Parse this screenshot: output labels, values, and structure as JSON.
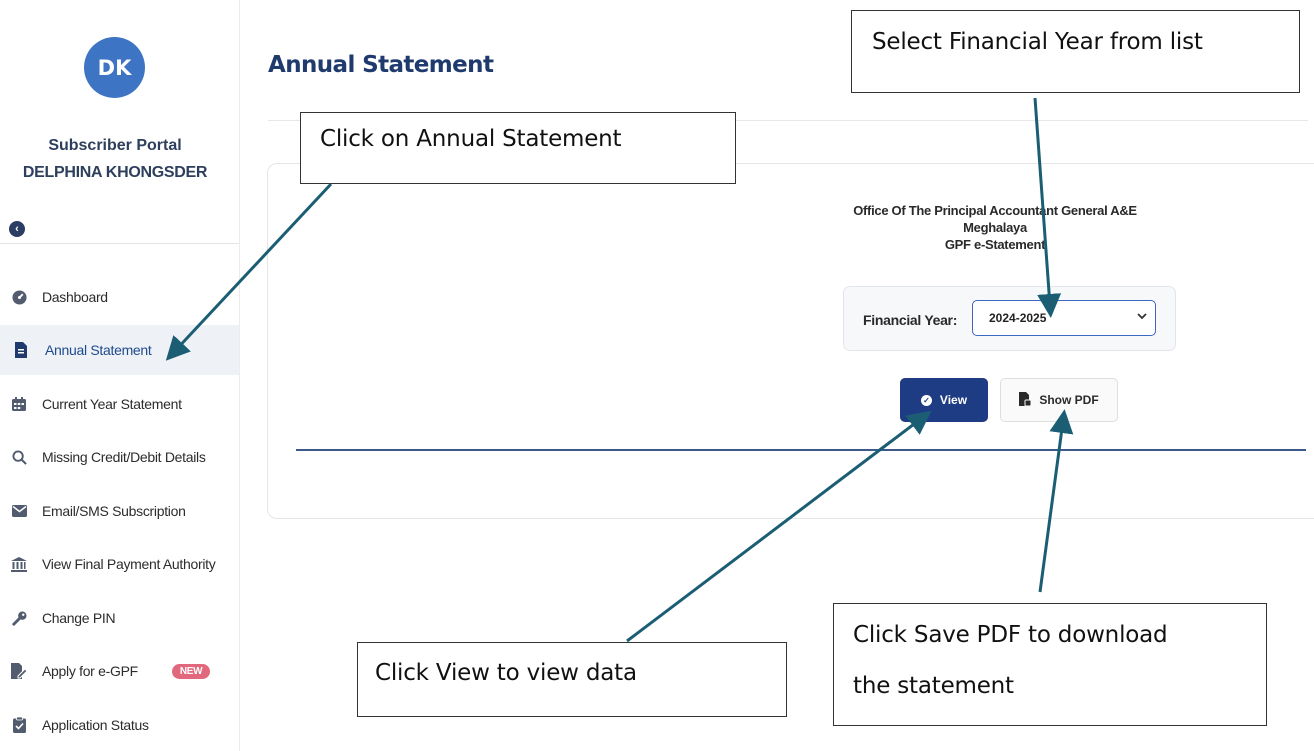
{
  "sidebar": {
    "avatar_initials": "DK",
    "portal_title": "Subscriber Portal",
    "user_name": "DELPHINA KHONGSDER",
    "items": [
      {
        "label": "Dashboard",
        "icon": "dashboard-gauge-icon"
      },
      {
        "label": "Annual Statement",
        "icon": "file-document-icon",
        "active": true
      },
      {
        "label": "Current Year Statement",
        "icon": "calendar-icon"
      },
      {
        "label": "Missing Credit/Debit Details",
        "icon": "search-icon"
      },
      {
        "label": "Email/SMS Subscription",
        "icon": "envelope-icon"
      },
      {
        "label": "View Final Payment Authority",
        "icon": "bank-building-icon"
      },
      {
        "label": "Change PIN",
        "icon": "key-icon"
      },
      {
        "label": "Apply for e-GPF",
        "icon": "file-edit-icon",
        "badge": "NEW"
      },
      {
        "label": "Application Status",
        "icon": "clipboard-check-icon"
      }
    ]
  },
  "main": {
    "title": "Annual Statement",
    "office": {
      "line1": "Office Of The Principal Accountant General A&E",
      "line2": "Meghalaya",
      "line3": "GPF e-Statement"
    },
    "financial_year": {
      "label": "Financial Year:",
      "selected": "2024-2025"
    },
    "buttons": {
      "view": "View",
      "show_pdf": "Show PDF"
    }
  },
  "callouts": {
    "annual_statement": "Click on Annual Statement",
    "financial_year": "Select Financial Year from list",
    "view": "Click View to view data",
    "save_pdf_line1": "Click Save PDF to download",
    "save_pdf_line2": "the statement"
  },
  "colors": {
    "brand_navy": "#1e3c84",
    "avatar_blue": "#3e74c4",
    "arrow_teal": "#1b5e74",
    "badge_pink": "#e2687e"
  }
}
